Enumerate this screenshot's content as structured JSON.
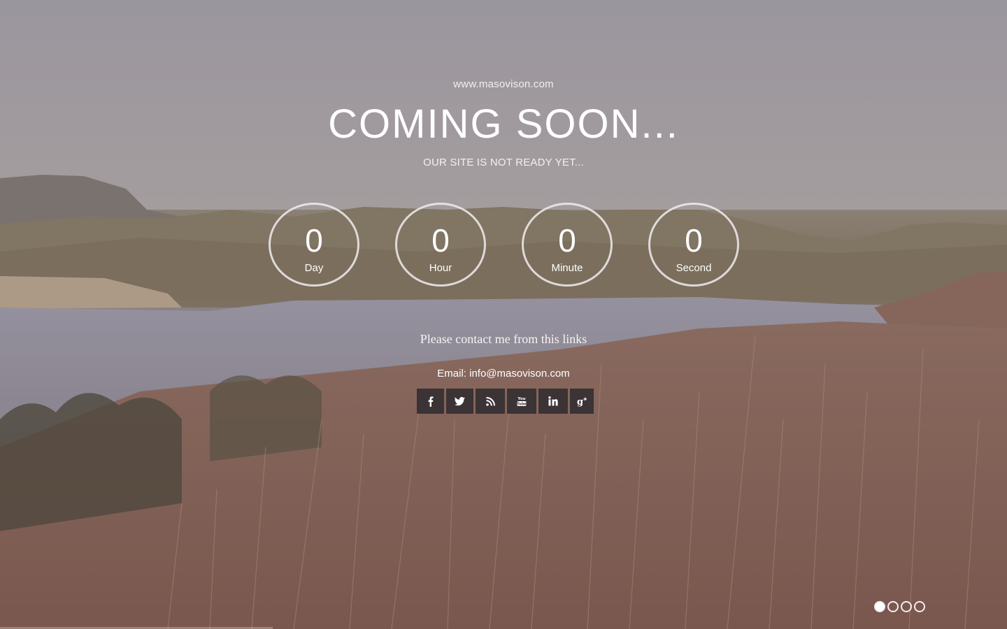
{
  "header": {
    "site_url": "www.masovison.com",
    "title": "COMING SOON...",
    "subtitle": "OUR SITE IS NOT READY YET..."
  },
  "countdown": [
    {
      "value": "0",
      "unit": "Day"
    },
    {
      "value": "0",
      "unit": "Hour"
    },
    {
      "value": "0",
      "unit": "Minute"
    },
    {
      "value": "0",
      "unit": "Second"
    }
  ],
  "contact": {
    "message": "Please contact me from this links",
    "email_text": "Email: info@masovison.com"
  },
  "social": [
    {
      "icon": "facebook-icon",
      "glyph": "f"
    },
    {
      "icon": "twitter-icon",
      "glyph": "🐦"
    },
    {
      "icon": "rss-icon",
      "glyph": "≈"
    },
    {
      "icon": "youtube-icon",
      "glyph": "You"
    },
    {
      "icon": "linkedin-icon",
      "glyph": "in"
    },
    {
      "icon": "google-plus-icon",
      "glyph": "g+"
    }
  ],
  "slider": {
    "count": 4,
    "active_index": 0
  },
  "colors": {
    "text": "#ffffff",
    "social_button_bg": "#3b3335",
    "circle_border": "#f0ecee"
  }
}
